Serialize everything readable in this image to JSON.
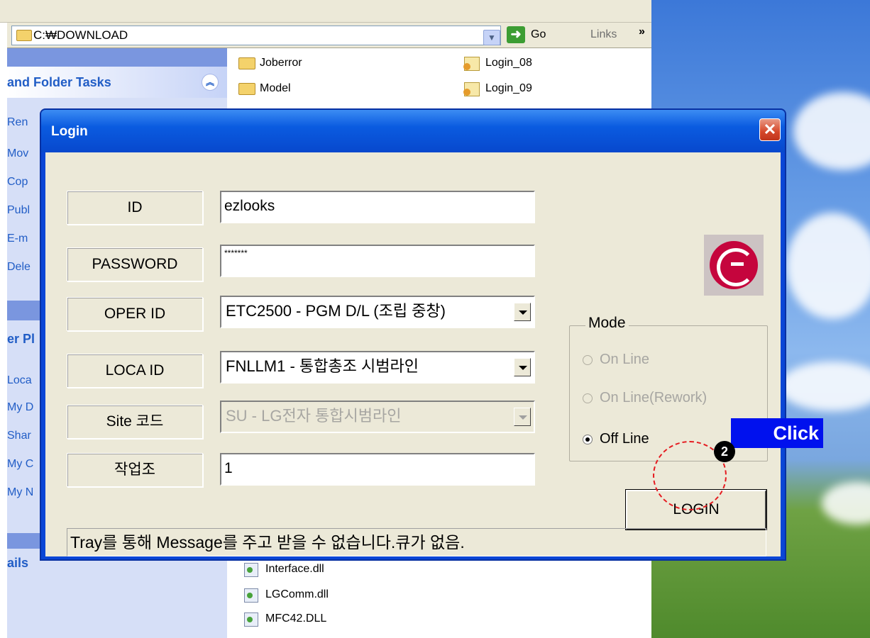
{
  "explorer": {
    "address": "C:₩DOWNLOAD",
    "go_label": "Go",
    "links_label": "Links",
    "chevron": "»",
    "taskpane": {
      "folder_tasks_title": "and Folder Tasks",
      "folder_task_items": [
        "Ren",
        "Mov",
        "Cop",
        "Publ",
        "E-m",
        "Dele"
      ],
      "other_places_title": "er Pl",
      "other_place_items": [
        "Loca",
        "My D",
        "Shar",
        "My C",
        "My N"
      ],
      "details_title": "ails"
    },
    "files_top": [
      {
        "name": "Joberror",
        "type": "folder"
      },
      {
        "name": "Model",
        "type": "folder"
      },
      {
        "name": "Login_08",
        "type": "file"
      },
      {
        "name": "Login_09",
        "type": "file"
      }
    ],
    "files_bottom": [
      {
        "name": "Interface.dll",
        "type": "dll"
      },
      {
        "name": "LGComm.dll",
        "type": "dll"
      },
      {
        "name": "MFC42.DLL",
        "type": "dll"
      }
    ]
  },
  "dialog": {
    "title": "Login",
    "close": "✕",
    "fields": {
      "id_label": "ID",
      "id_value": "ezlooks",
      "password_label": "PASSWORD",
      "password_value": "*******",
      "oper_label": "OPER ID",
      "oper_value": "ETC2500 - PGM D/L (조립 중창)",
      "loca_label": "LOCA ID",
      "loca_value": "FNLLM1 - 통합총조 시범라인",
      "site_label": "Site 코드",
      "site_value": "SU - LG전자 통합시범라인",
      "team_label": "작업조",
      "team_value": "1"
    },
    "mode": {
      "legend": "Mode",
      "options": [
        {
          "label": "On Line",
          "selected": false,
          "enabled": false
        },
        {
          "label": "On Line(Rework)",
          "selected": false,
          "enabled": false
        },
        {
          "label": "Off Line",
          "selected": true,
          "enabled": true
        }
      ]
    },
    "login_button": "LOGIN",
    "status_message": "Tray를 통해 Message를 주고 받을 수 없습니다.큐가 없음."
  },
  "annotation": {
    "click_label": "Click",
    "step_number": "2"
  },
  "colors": {
    "title_bar": "#0a5be0",
    "dialog_face": "#ece9d8",
    "annotation_blue": "#0011ee",
    "annotation_red": "#e51b20",
    "lg_red": "#c5053d"
  }
}
